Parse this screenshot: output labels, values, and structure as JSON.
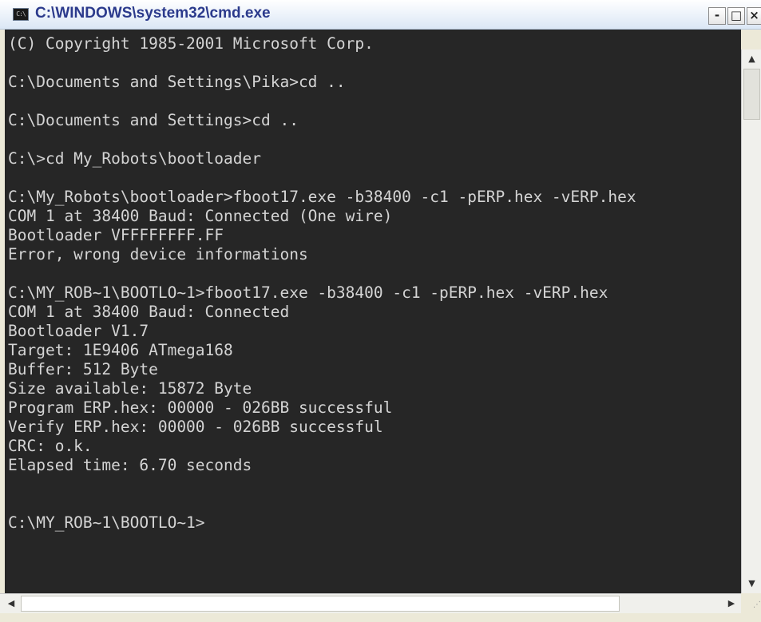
{
  "window": {
    "title": "C:\\WINDOWS\\system32\\cmd.exe",
    "icon_label": "C:\\",
    "icon": "console-icon"
  },
  "caption_buttons": {
    "minimize": "-",
    "maximize": "□",
    "close": "×"
  },
  "console": {
    "lines": [
      "(C) Copyright 1985-2001 Microsoft Corp.",
      "",
      "C:\\Documents and Settings\\Pika>cd ..",
      "",
      "C:\\Documents and Settings>cd ..",
      "",
      "C:\\>cd My_Robots\\bootloader",
      "",
      "C:\\My_Robots\\bootloader>fboot17.exe -b38400 -c1 -pERP.hex -vERP.hex",
      "COM 1 at 38400 Baud: Connected (One wire)",
      "Bootloader VFFFFFFFF.FF",
      "Error, wrong device informations",
      "",
      "C:\\MY_ROB~1\\BOOTLO~1>fboot17.exe -b38400 -c1 -pERP.hex -vERP.hex",
      "COM 1 at 38400 Baud: Connected",
      "Bootloader V1.7",
      "Target: 1E9406 ATmega168",
      "Buffer: 512 Byte",
      "Size available: 15872 Byte",
      "Program ERP.hex: 00000 - 026BB successful",
      "Verify ERP.hex: 00000 - 026BB successful",
      "CRC: o.k.",
      "Elapsed time: 6.70 seconds",
      "",
      "",
      "C:\\MY_ROB~1\\BOOTLO~1>"
    ],
    "colors": {
      "background": "#262626",
      "text": "#d4d4d4"
    }
  },
  "scrollbars": {
    "up_arrow": "▲",
    "down_arrow": "▼",
    "left_arrow": "◀",
    "right_arrow": "▶"
  }
}
